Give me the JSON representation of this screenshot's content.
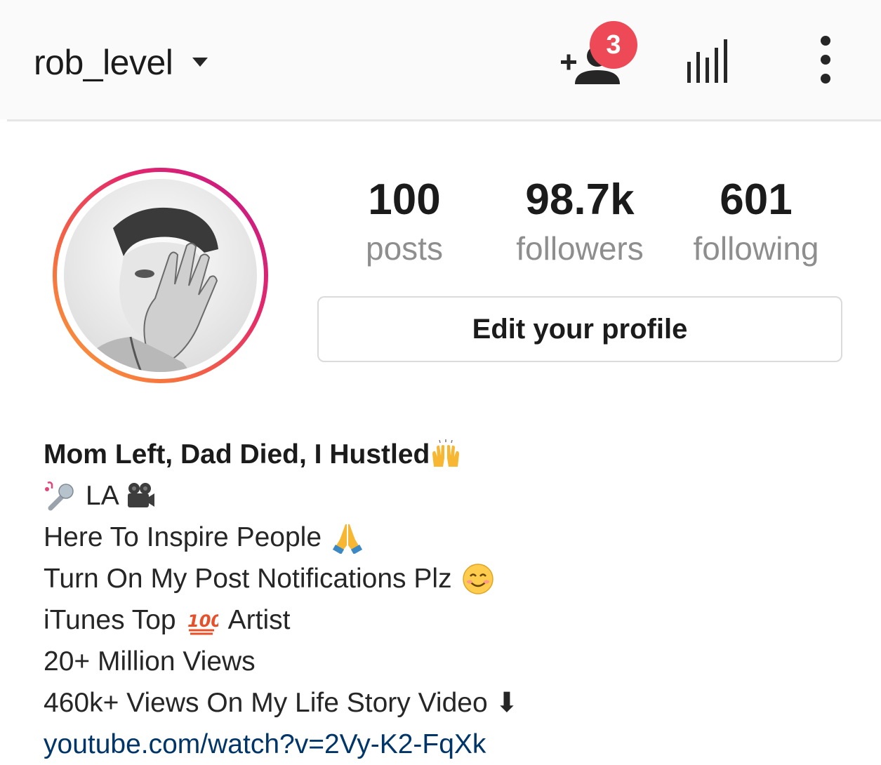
{
  "header": {
    "username": "rob_level",
    "notification_count": "3",
    "icons": {
      "switch_account": "chevron-down-icon",
      "discover_people": "add-person-icon",
      "insights": "bar-chart-icon",
      "options": "more-vertical-icon"
    }
  },
  "profile": {
    "avatar_icon": "profile-photo",
    "stats": [
      {
        "value": "100",
        "label": "posts"
      },
      {
        "value": "98.7k",
        "label": "followers"
      },
      {
        "value": "601",
        "label": "following"
      }
    ],
    "edit_button": "Edit your profile"
  },
  "bio": {
    "name": "Mom Left, Dad Died, I Hustled",
    "name_emoji": "raising-hands-emoji",
    "lines": [
      {
        "text": "LA",
        "emoji_before": "microphone-emoji",
        "emoji_after": "movie-camera-emoji"
      },
      {
        "text": "Here To Inspire People",
        "emoji_after": "folded-hands-emoji"
      },
      {
        "text": "Turn On My Post Notifications Plz",
        "emoji_after": "smiling-face-emoji"
      },
      {
        "text_before": "iTunes Top",
        "emoji": "hundred-points-emoji",
        "text_after": "Artist"
      },
      {
        "text": "20+ Million Views"
      },
      {
        "text": "460k+ Views On My Life Story Video ⬇"
      }
    ],
    "link": "youtube.com/watch?v=2Vy-K2-FqXk"
  },
  "colors": {
    "badge": "#ed4956",
    "link": "#003569",
    "secondary_text": "#8e8e8e",
    "ring_gradient": [
      "#f9a33b",
      "#e4286b",
      "#c0168c"
    ]
  }
}
